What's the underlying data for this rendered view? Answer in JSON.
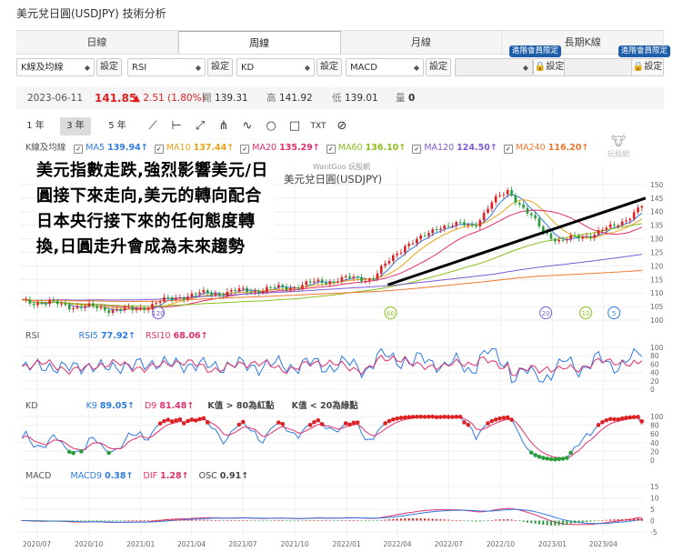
{
  "page": {
    "title": "美元兌日圓(USDJPY) 技術分析"
  },
  "tabs": [
    {
      "label": "日線"
    },
    {
      "label": "周線",
      "active": true
    },
    {
      "label": "月線"
    },
    {
      "label": "長期K線"
    }
  ],
  "member_badge": "進階會員限定",
  "selectors": {
    "main": "K線及均線",
    "ind1": "RSI",
    "ind2": "KD",
    "ind3": "MACD",
    "setting": "設定"
  },
  "quote": {
    "date": "2023-06-11",
    "close": "141.85",
    "change": "▲ 2.51 (1.80%)",
    "open_label": "開",
    "open": "139.31",
    "high_label": "高",
    "high": "141.92",
    "low_label": "低",
    "low": "139.01",
    "vol_label": "量",
    "vol": "0"
  },
  "range_buttons": [
    "1 年",
    "3 年",
    "5 年"
  ],
  "tool_icons": [
    "line-icon",
    "horizontal-line-icon",
    "trend-icon",
    "wave-icon",
    "circle-icon",
    "square-icon",
    "text-icon",
    "hide-icon"
  ],
  "ma_legend": {
    "label": "K線及均線",
    "items": [
      {
        "name": "MA5",
        "value": "139.94↑",
        "color": "#2f7be0"
      },
      {
        "name": "MA10",
        "value": "137.44↑",
        "color": "#e8a317"
      },
      {
        "name": "MA20",
        "value": "135.29↑",
        "color": "#e0306e"
      },
      {
        "name": "MA60",
        "value": "136.10↑",
        "color": "#8bbf1c"
      },
      {
        "name": "MA120",
        "value": "124.50↑",
        "color": "#7b5cd6"
      },
      {
        "name": "MA240",
        "value": "116.20↑",
        "color": "#f07830"
      }
    ]
  },
  "annotation": "美元指數走跌,強烈影響美元/日圓接下來走向,美元的轉向配合日本央行接下來的任何態度轉換,日圓走升會成為未來趨勢",
  "watermark": "WantGoo 玩股網",
  "logo_text": "玩股網",
  "colors": {
    "up": "#e02020",
    "down": "#2a9d3b",
    "rsi5": "#2f7be0",
    "rsi10": "#e0306e",
    "k": "#2f7be0",
    "d": "#e0306e",
    "dif": "#e0306e",
    "macd": "#2f7be0",
    "trendline": "#000000"
  },
  "chart_data": [
    {
      "type": "candlestick",
      "title": "美元兌日圓(USDJPY)",
      "ylim": [
        100,
        155
      ],
      "yticks": [
        100,
        105,
        110,
        115,
        120,
        125,
        130,
        135,
        140,
        145,
        150
      ],
      "x_ticks": [
        "2020/07",
        "2020/10",
        "2021/01",
        "2021/04",
        "2021/07",
        "2021/10",
        "2022/01",
        "2022/04",
        "2022/07",
        "2022/10",
        "2023/01",
        "2023/04"
      ],
      "close_series": {
        "x": [
          "2020-06",
          "2020-09",
          "2020-12",
          "2021-03",
          "2021-06",
          "2021-09",
          "2021-12",
          "2022-02",
          "2022-03",
          "2022-04",
          "2022-05",
          "2022-06",
          "2022-08",
          "2022-09",
          "2022-10",
          "2022-11",
          "2022-12",
          "2023-01",
          "2023-03",
          "2023-04",
          "2023-05",
          "2023-06"
        ],
        "values": [
          107,
          105,
          103.5,
          109,
          110.5,
          112,
          115,
          115.5,
          121,
          128,
          130,
          135,
          135,
          143,
          148,
          140,
          133,
          129,
          132,
          134,
          138,
          141.85
        ]
      },
      "moving_averages": [
        {
          "name": "MA5",
          "last": 139.94
        },
        {
          "name": "MA10",
          "last": 137.44
        },
        {
          "name": "MA20",
          "last": 135.29
        },
        {
          "name": "MA60",
          "last": 136.1
        },
        {
          "name": "MA120",
          "last": 124.5
        },
        {
          "name": "MA240",
          "last": 116.2
        }
      ],
      "trendline": {
        "from": [
          "2022-03",
          113
        ],
        "to": [
          "2023-06",
          145
        ]
      },
      "ma_cross_markers": [
        "120",
        "60",
        "20",
        "10",
        "5"
      ]
    },
    {
      "type": "line",
      "title": "RSI",
      "series": [
        {
          "name": "RSI5",
          "last": 77.92
        },
        {
          "name": "RSI10",
          "last": 68.06
        }
      ],
      "ylim": [
        0,
        100
      ],
      "yticks": [
        0,
        20,
        40,
        60,
        80,
        100
      ]
    },
    {
      "type": "line",
      "title": "KD",
      "series": [
        {
          "name": "K9",
          "last": 89.05
        },
        {
          "name": "D9",
          "last": 81.48
        }
      ],
      "notes": [
        "K值 > 80為紅點",
        "K值 < 20為綠點"
      ],
      "ylim": [
        0,
        100
      ],
      "yticks": [
        0,
        20,
        40,
        60,
        80,
        100
      ]
    },
    {
      "type": "line",
      "title": "MACD",
      "series": [
        {
          "name": "MACD9",
          "last": 0.38
        },
        {
          "name": "DIF",
          "last": 1.28
        },
        {
          "name": "OSC",
          "last": 0.91
        }
      ],
      "ylim": [
        -5,
        15
      ],
      "yticks": [
        -5,
        0,
        5,
        10,
        15
      ]
    }
  ]
}
